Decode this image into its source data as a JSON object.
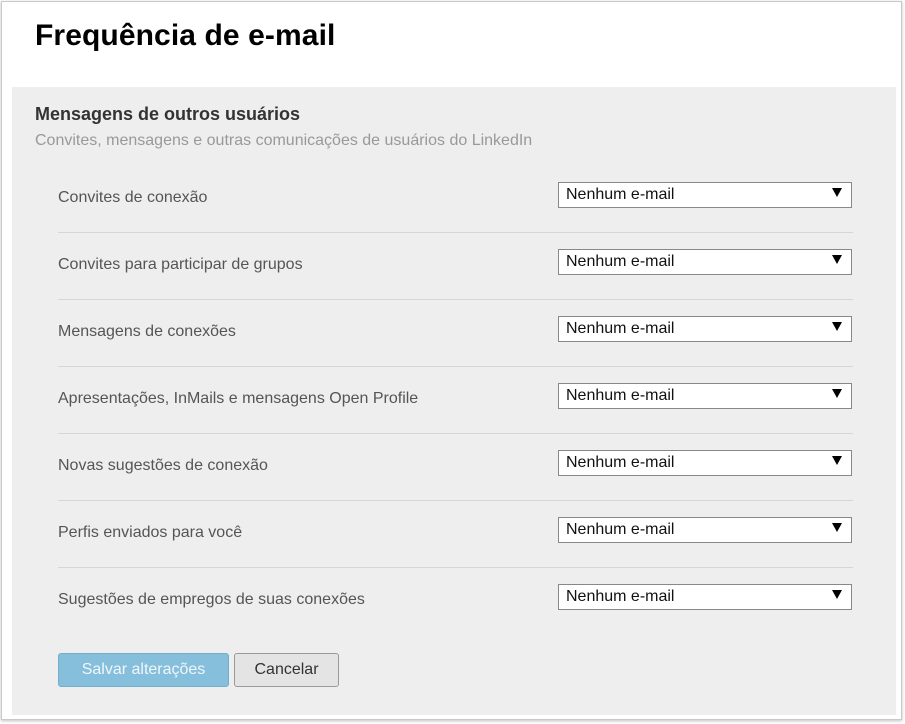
{
  "page": {
    "title": "Frequência de e-mail"
  },
  "section": {
    "title": "Mensagens de outros usuários",
    "subtitle": "Convites, mensagens e outras comunicações de usuários do LinkedIn"
  },
  "settings": [
    {
      "label": "Convites de conexão",
      "value": "Nenhum e-mail"
    },
    {
      "label": "Convites para participar de grupos",
      "value": "Nenhum e-mail"
    },
    {
      "label": "Mensagens de conexões",
      "value": "Nenhum e-mail"
    },
    {
      "label": "Apresentações, InMails e mensagens Open Profile",
      "value": "Nenhum e-mail"
    },
    {
      "label": "Novas sugestões de conexão",
      "value": "Nenhum e-mail"
    },
    {
      "label": "Perfis enviados para você",
      "value": "Nenhum e-mail"
    },
    {
      "label": "Sugestões de empregos de suas conexões",
      "value": "Nenhum e-mail"
    }
  ],
  "actions": {
    "save_label": "Salvar alterações",
    "cancel_label": "Cancelar"
  },
  "icons": {
    "dropdown": "chevron-down-icon"
  },
  "colors": {
    "panel_background": "#eeeeee",
    "save_button": "#86bfdb",
    "cancel_button": "#e4e4e4"
  }
}
